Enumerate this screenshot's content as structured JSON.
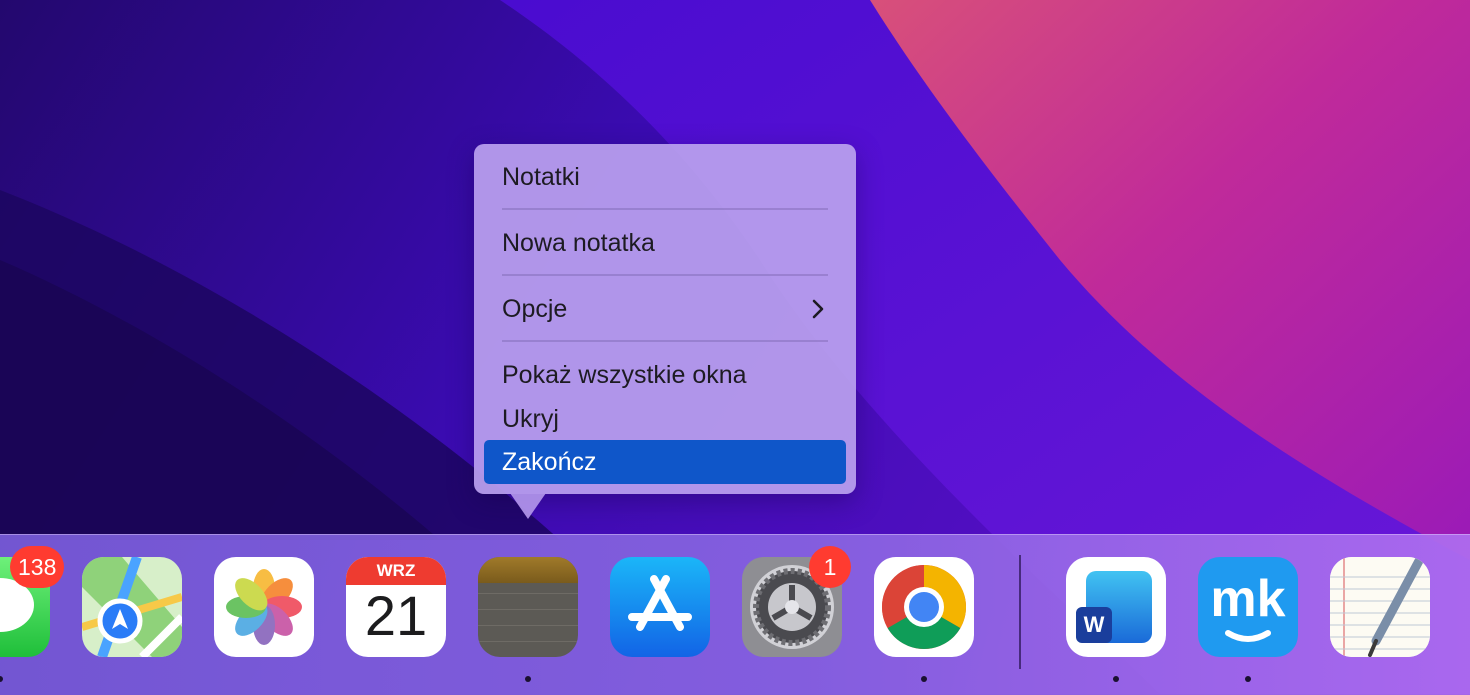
{
  "context_menu": {
    "items": [
      {
        "label": "Notatki"
      },
      {
        "label": "Nowa notatka"
      },
      {
        "label": "Opcje"
      },
      {
        "label": "Pokaż wszystkie okna"
      },
      {
        "label": "Ukryj"
      },
      {
        "label": "Zakończ"
      }
    ],
    "highlight_color": "#0f56c9"
  },
  "dock": {
    "apps": [
      {
        "name": "messages-app",
        "badge": "138",
        "running": true
      },
      {
        "name": "maps-app",
        "running": false
      },
      {
        "name": "photos-app",
        "running": false
      },
      {
        "name": "calendar-app",
        "month": "WRZ",
        "day": "21",
        "running": false
      },
      {
        "name": "notes-app",
        "running": true
      },
      {
        "name": "app-store-app",
        "running": false
      },
      {
        "name": "system-preferences-app",
        "badge": "1",
        "running": false
      },
      {
        "name": "chrome-app",
        "running": true
      },
      {
        "name": "word-app",
        "letter": "W",
        "running": true
      },
      {
        "name": "mk-app",
        "logo_text": "mk",
        "running": true
      },
      {
        "name": "textedit-app",
        "running": false
      }
    ]
  }
}
